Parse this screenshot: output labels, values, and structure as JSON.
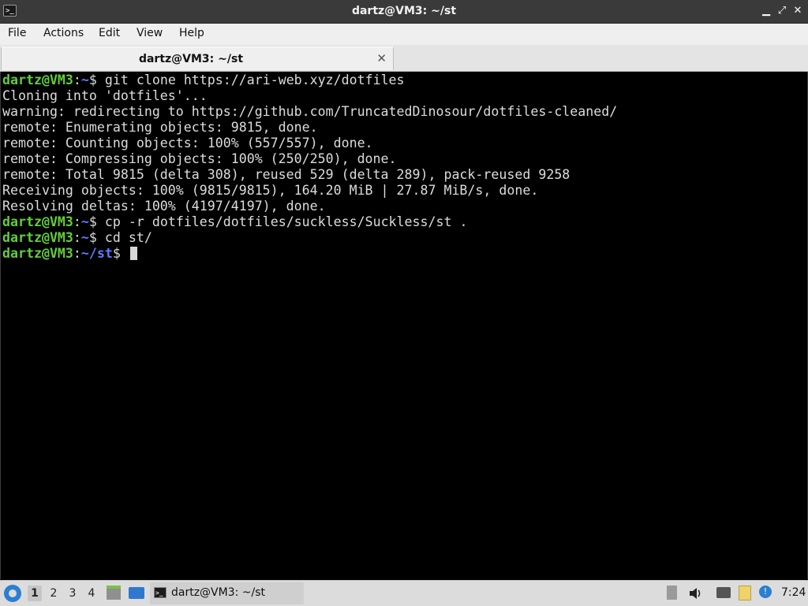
{
  "window": {
    "title": "dartz@VM3: ~/st",
    "minimize_glyph": "▁",
    "maximize_glyph": "⤢",
    "close_glyph": "✕"
  },
  "menubar": {
    "items": [
      {
        "label": "File"
      },
      {
        "label": "Actions"
      },
      {
        "label": "Edit"
      },
      {
        "label": "View"
      },
      {
        "label": "Help"
      }
    ]
  },
  "tabs": [
    {
      "label": "dartz@VM3: ~/st",
      "close": "✕"
    }
  ],
  "terminal": {
    "prompt_user": "dartz@VM3",
    "lines": {
      "cmd1": {
        "path": "~",
        "cmd": " git clone https://ari-web.xyz/dotfiles"
      },
      "out1": "Cloning into 'dotfiles'...",
      "out2": "warning: redirecting to https://github.com/TruncatedDinosour/dotfiles-cleaned/",
      "out3": "remote: Enumerating objects: 9815, done.",
      "out4": "remote: Counting objects: 100% (557/557), done.",
      "out5": "remote: Compressing objects: 100% (250/250), done.",
      "out6": "remote: Total 9815 (delta 308), reused 529 (delta 289), pack-reused 9258",
      "out7": "Receiving objects: 100% (9815/9815), 164.20 MiB | 27.87 MiB/s, done.",
      "out8": "Resolving deltas: 100% (4197/4197), done.",
      "cmd2": {
        "path": "~",
        "cmd": " cp -r dotfiles/dotfiles/suckless/Suckless/st ."
      },
      "cmd3": {
        "path": "~",
        "cmd": " cd st/"
      },
      "cmd4": {
        "path": "~/st",
        "cmd": " "
      }
    },
    "colors": {
      "user": "#5fd03a",
      "path": "#5a7cff",
      "text": "#dcdcdc"
    }
  },
  "taskbar": {
    "workspaces": [
      "1",
      "2",
      "3",
      "4"
    ],
    "active_workspace": "1",
    "task": {
      "label": "dartz@VM3: ~/st"
    },
    "clock": "7:24"
  }
}
